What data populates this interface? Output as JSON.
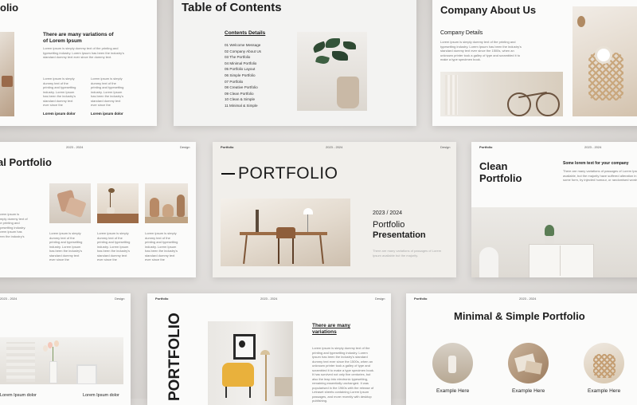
{
  "slides": {
    "top_left": {
      "heading": "There are many variations of\nof Lorem Ipsum",
      "body": "Lorem ipsum is simply dummy text of the printing and typesetting industry. Lorem Ipsum has been the industry's standard dummy text ever since the dummy text.",
      "col1_body": "Lorem ipsum is simply dummy text of the printing and typesetting industry. Lorem Ipsum has been the industry's standard dummy text ever since the",
      "col2_body": "Lorem ipsum is simply dummy text of the printing and typesetting industry. Lorem Ipsum has been the industry's standard dummy text ever since the",
      "col1_label": "Lorem ipsum dolor",
      "col2_label": "Lorem ipsum dolor",
      "title_fragment": "olio"
    },
    "toc": {
      "title": "Table of Contents",
      "subtitle": "Contents Details",
      "items": [
        "01 Welcome Message",
        "02 Company About Us",
        "03 The Portfolio",
        "04 Minimal Portfolio",
        "05 Portfolio Layout",
        "06 Simple Portfolio",
        "07 Portfolio",
        "08 Creative Portfolio",
        "09 Clean Portfolio",
        "10 Clean & Simple",
        "11 Minimal & Simple"
      ]
    },
    "about": {
      "title": "Company About Us",
      "subtitle": "Company Details",
      "body": "Lorem ipsum is simply dummy text of the printing and typesetting industry. Lorem Ipsum has been the industry's standard dummy text ever since the 1500s, when an unknown printer took a galley of type and scrambled it to make a type specimen book."
    },
    "mid_left": {
      "title": "al Portfolio",
      "header_year": "2023 - 2024",
      "header_right": "Design",
      "col0_body": "Lorem ipsum is simply dummy text of the printing and typesetting industry. Lorem ipsum has been the industry's",
      "col1_body": "Lorem ipsum is simply dummy text of the printing and typesetting industry. Lorem Ipsum has been the industry's standard dummy text ever since the",
      "col2_body": "Lorem ipsum is simply dummy text of the printing and typesetting industry. Lorem Ipsum has been the industry's standard dummy text ever since the",
      "col3_body": "Lorem ipsum is simply dummy text of the printing and typesetting industry. Lorem Ipsum has been the industry's standard dummy text ever since the"
    },
    "cover": {
      "header_left": "Portfolio",
      "header_year": "2023 - 2024",
      "header_right": "Design",
      "title": "PORTFOLIO",
      "year": "2023 / 2024",
      "line1": "Portfolio",
      "line2": "Presentation",
      "tagline": "There are many variations of passages of Lorem Ipsum available but the majority."
    },
    "clean": {
      "header_left": "Portfolio",
      "header_year": "2023 - 2024",
      "title_line1": "Clean",
      "title_line2": "Portfolio",
      "subtitle": "Some lorem text for your company",
      "body": "There are many variations of passages of Lorem Ipsum available, but the majority have suffered alteration in some form, by injected humour, or randomised words."
    },
    "bottom_left": {
      "header_year": "2023 - 2024",
      "header_right": "Design",
      "label1": "Lorem Ipsum dolor",
      "label2": "Lorem Ipsum dolor"
    },
    "vertical": {
      "header_left": "Portfolio",
      "header_year": "2023 - 2024",
      "header_right": "Design",
      "title": "PORTFOLIO",
      "heading": "There are many\nvariations",
      "body": "Lorem ipsum is simply dummy text of the printing and typesetting industry. Lorem Ipsum has been the industry's standard dummy text ever since the 1500s, when an unknown printer took a galley of type and scrambled it to make a type specimen book. It has survived not only five centuries, but also the leap into electronic typesetting, remaining essentially unchanged. It was popularised in the 1960s with the release of Letraset sheets containing Lorem Ipsum passages, and more recently with desktop publishing."
    },
    "minimal": {
      "header_left": "Portfolio",
      "header_year": "2023 - 2024",
      "title": "Minimal & Simple Portfolio",
      "example1": "Example Here",
      "example2": "Example Here",
      "example3": "Example Here"
    }
  }
}
